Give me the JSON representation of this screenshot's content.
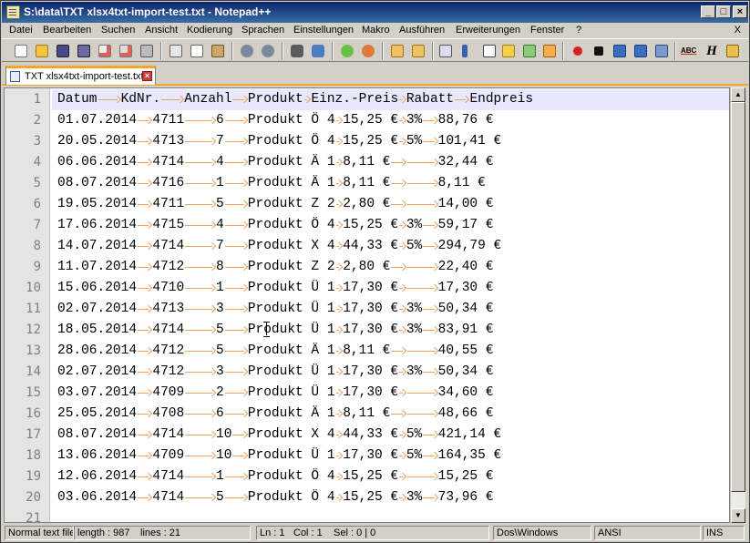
{
  "window": {
    "title": "S:\\data\\TXT xlsx4txt-import-test.txt - Notepad++",
    "minimize": "_",
    "maximize": "□",
    "close": "×"
  },
  "menu": [
    "Datei",
    "Bearbeiten",
    "Suchen",
    "Ansicht",
    "Kodierung",
    "Sprachen",
    "Einstellungen",
    "Makro",
    "Ausführen",
    "Erweiterungen",
    "Fenster",
    "?"
  ],
  "menu_close": "X",
  "toolbar": {
    "icons": [
      "new-file-icon",
      "open-file-icon",
      "save-icon",
      "save-all-icon",
      "close-icon",
      "close-all-icon",
      "print-icon",
      "cut-icon",
      "copy-icon",
      "paste-icon",
      "undo-icon",
      "redo-icon",
      "find-icon",
      "replace-icon",
      "zoom-in-icon",
      "zoom-out-icon",
      "sync-v-icon",
      "sync-h-icon",
      "word-wrap-icon",
      "show-all-chars-icon",
      "indent-guide-icon",
      "doc-map-icon",
      "function-list-icon",
      "folder-workspace-icon",
      "record-macro-icon",
      "stop-macro-icon",
      "play-macro-icon",
      "run-macro-multiple-icon",
      "save-macro-icon",
      "spell-check-icon",
      "hex-icon",
      "compare-icon"
    ],
    "spellcheck_label": "ABC",
    "hex_label": "H"
  },
  "tab": {
    "label": "TXT xlsx4txt-import-test.txt"
  },
  "editor": {
    "line_numbers": [
      "1",
      "2",
      "3",
      "4",
      "5",
      "6",
      "7",
      "8",
      "9",
      "10",
      "11",
      "12",
      "13",
      "14",
      "15",
      "16",
      "17",
      "18",
      "19",
      "20",
      "21"
    ],
    "lines": [
      [
        "Datum",
        "KdNr.",
        "Anzahl",
        "Produkt",
        "Einz.-Preis",
        "Rabatt",
        "Endpreis"
      ],
      [
        "01.07.2014",
        "4711",
        "6",
        "Produkt Ö 4",
        "15,25 €",
        "3%",
        "88,76 €"
      ],
      [
        "20.05.2014",
        "4713",
        "7",
        "Produkt Ö 4",
        "15,25 €",
        "5%",
        "101,41 €"
      ],
      [
        "06.06.2014",
        "4714",
        "4",
        "Produkt Ä 1",
        "8,11 €",
        "",
        "32,44 €"
      ],
      [
        "08.07.2014",
        "4716",
        "1",
        "Produkt Ä 1",
        "8,11 €",
        "",
        "8,11 €"
      ],
      [
        "19.05.2014",
        "4711",
        "5",
        "Produkt Z 2",
        "2,80 €",
        "",
        "14,00 €"
      ],
      [
        "17.06.2014",
        "4715",
        "4",
        "Produkt Ö 4",
        "15,25 €",
        "3%",
        "59,17 €"
      ],
      [
        "14.07.2014",
        "4714",
        "7",
        "Produkt X 4",
        "44,33 €",
        "5%",
        "294,79 €"
      ],
      [
        "11.07.2014",
        "4712",
        "8",
        "Produkt Z 2",
        "2,80 €",
        "",
        "22,40 €"
      ],
      [
        "15.06.2014",
        "4710",
        "1",
        "Produkt Ü 1",
        "17,30 €",
        "",
        "17,30 €"
      ],
      [
        "02.07.2014",
        "4713",
        "3",
        "Produkt Ü 1",
        "17,30 €",
        "3%",
        "50,34 €"
      ],
      [
        "18.05.2014",
        "4714",
        "5",
        "Produkt Ü 1",
        "17,30 €",
        "3%",
        "83,91 €"
      ],
      [
        "28.06.2014",
        "4712",
        "5",
        "Produkt Ä 1",
        "8,11 €",
        "",
        "40,55 €"
      ],
      [
        "02.07.2014",
        "4712",
        "3",
        "Produkt Ü 1",
        "17,30 €",
        "3%",
        "50,34 €"
      ],
      [
        "03.07.2014",
        "4709",
        "2",
        "Produkt Ü 1",
        "17,30 €",
        "",
        "34,60 €"
      ],
      [
        "25.05.2014",
        "4708",
        "6",
        "Produkt Ä 1",
        "8,11 €",
        "",
        "48,66 €"
      ],
      [
        "08.07.2014",
        "4714",
        "10",
        "Produkt X 4",
        "44,33 €",
        "5%",
        "421,14 €"
      ],
      [
        "13.06.2014",
        "4709",
        "10",
        "Produkt Ü 1",
        "17,30 €",
        "5%",
        "164,35 €"
      ],
      [
        "12.06.2014",
        "4714",
        "1",
        "Produkt Ö 4",
        "15,25 €",
        "",
        "15,25 €"
      ],
      [
        "03.06.2014",
        "4714",
        "5",
        "Produkt Ö 4",
        "15,25 €",
        "3%",
        "73,96 €"
      ]
    ]
  },
  "statusbar": {
    "type": "Normal text file",
    "length": "length : 987",
    "lines": "lines : 21",
    "ln": "Ln : 1",
    "col": "Col : 1",
    "sel": "Sel : 0 | 0",
    "eol": "Dos\\Windows",
    "encoding": "ANSI",
    "mode": "INS"
  }
}
